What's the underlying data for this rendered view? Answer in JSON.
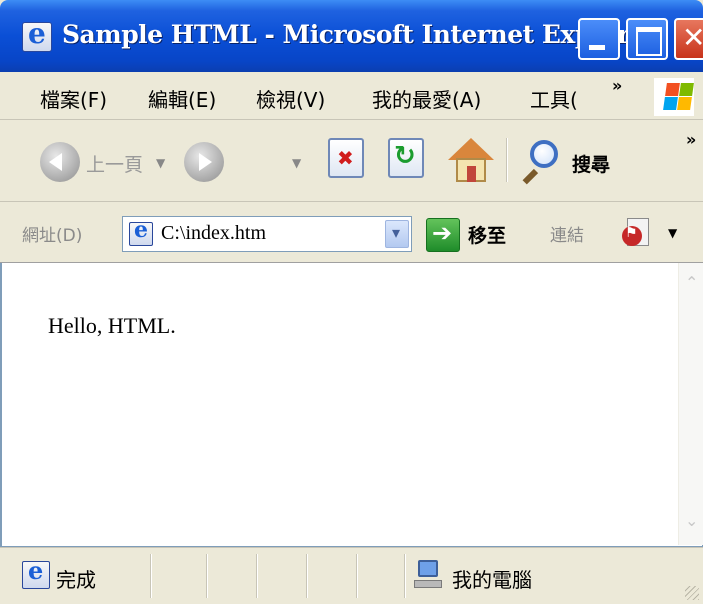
{
  "window": {
    "title": "Sample HTML - Microsoft Internet Explorer"
  },
  "menu": {
    "items": [
      "檔案(F)",
      "編輯(E)",
      "檢視(V)",
      "我的最愛(A)",
      "工具("
    ],
    "overflow": "»"
  },
  "toolbar": {
    "back_label": "上一頁",
    "search_label": "搜尋",
    "overflow": "»"
  },
  "address": {
    "label": "網址(D)",
    "value": "C:\\index.htm",
    "go_label": "移至",
    "links_label": "連結"
  },
  "content": {
    "text": "Hello, HTML."
  },
  "status": {
    "text": "完成",
    "zone": "我的電腦"
  },
  "colors": {
    "titlebar": "#0a4fd6",
    "chrome": "#ece9d8",
    "content_bg": "#ffffff"
  },
  "icons": [
    "ie-icon",
    "minimize-icon",
    "maximize-icon",
    "close-icon",
    "windows-logo-icon",
    "back-icon",
    "forward-icon",
    "stop-icon",
    "refresh-icon",
    "home-icon",
    "search-icon",
    "go-arrow-icon",
    "pdf-icon",
    "computer-icon"
  ]
}
